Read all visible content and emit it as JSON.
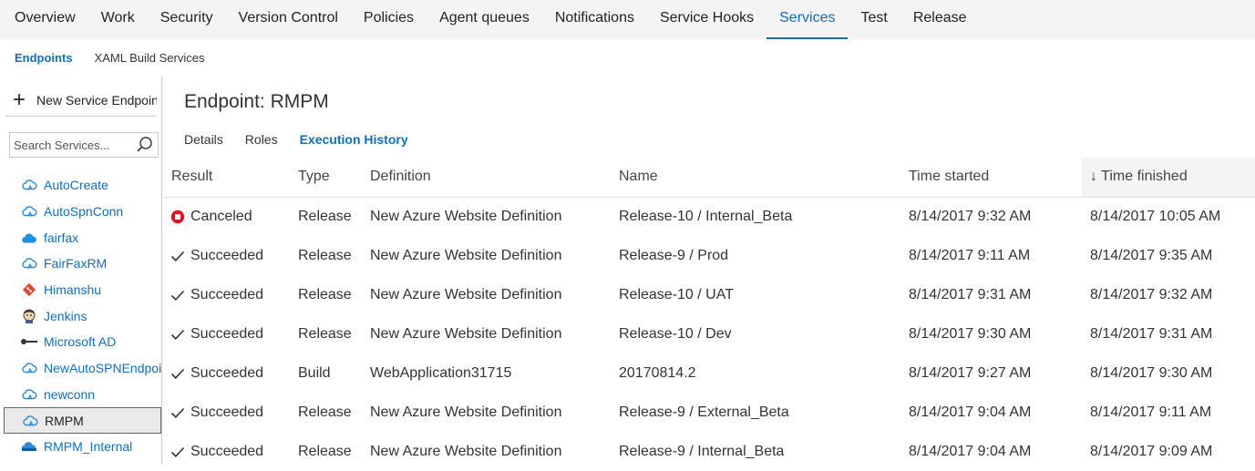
{
  "topnav": {
    "tabs": [
      "Overview",
      "Work",
      "Security",
      "Version Control",
      "Policies",
      "Agent queues",
      "Notifications",
      "Service Hooks",
      "Services",
      "Test",
      "Release"
    ],
    "active": "Services"
  },
  "subnav": {
    "endpoints": "Endpoints",
    "xaml": "XAML Build Services"
  },
  "left": {
    "new_button": "New Service Endpoint",
    "search_placeholder": "Search Services...",
    "services": [
      {
        "label": "AutoCreate",
        "icon": "azure-cloud-icon"
      },
      {
        "label": "AutoSpnConn",
        "icon": "azure-cloud-icon"
      },
      {
        "label": "fairfax",
        "icon": "cloud-icon"
      },
      {
        "label": "FairFaxRM",
        "icon": "azure-cloud-icon"
      },
      {
        "label": "Himanshu",
        "icon": "git-icon"
      },
      {
        "label": "Jenkins",
        "icon": "jenkins-icon"
      },
      {
        "label": "Microsoft AD",
        "icon": "key-icon"
      },
      {
        "label": "NewAutoSPNEndpoint",
        "icon": "azure-cloud-icon"
      },
      {
        "label": "newconn",
        "icon": "azure-cloud-icon"
      },
      {
        "label": "RMPM",
        "icon": "azure-cloud-icon"
      },
      {
        "label": "RMPM_Internal",
        "icon": "azure-rm-icon"
      }
    ],
    "selected": "RMPM"
  },
  "main": {
    "title": "Endpoint: RMPM",
    "tabs": [
      "Details",
      "Roles",
      "Execution History"
    ],
    "active_tab": "Execution History",
    "columns": [
      "Result",
      "Type",
      "Definition",
      "Name",
      "Time started",
      "Time finished"
    ],
    "sort_arrow": "↓",
    "rows": [
      {
        "result": "Canceled",
        "status": "canceled",
        "type": "Release",
        "definition": "New Azure Website Definition",
        "name": "Release-10 / Internal_Beta",
        "started": "8/14/2017 9:32 AM",
        "finished": "8/14/2017 10:05 AM"
      },
      {
        "result": "Succeeded",
        "status": "succeeded",
        "type": "Release",
        "definition": "New Azure Website Definition",
        "name": "Release-9 / Prod",
        "started": "8/14/2017 9:11 AM",
        "finished": "8/14/2017 9:35 AM"
      },
      {
        "result": "Succeeded",
        "status": "succeeded",
        "type": "Release",
        "definition": "New Azure Website Definition",
        "name": "Release-10 / UAT",
        "started": "8/14/2017 9:31 AM",
        "finished": "8/14/2017 9:32 AM"
      },
      {
        "result": "Succeeded",
        "status": "succeeded",
        "type": "Release",
        "definition": "New Azure Website Definition",
        "name": "Release-10 / Dev",
        "started": "8/14/2017 9:30 AM",
        "finished": "8/14/2017 9:31 AM"
      },
      {
        "result": "Succeeded",
        "status": "succeeded",
        "type": "Build",
        "definition": "WebApplication31715",
        "name": "20170814.2",
        "started": "8/14/2017 9:27 AM",
        "finished": "8/14/2017 9:30 AM"
      },
      {
        "result": "Succeeded",
        "status": "succeeded",
        "type": "Release",
        "definition": "New Azure Website Definition",
        "name": "Release-9 / External_Beta",
        "started": "8/14/2017 9:04 AM",
        "finished": "8/14/2017 9:11 AM"
      },
      {
        "result": "Succeeded",
        "status": "succeeded",
        "type": "Release",
        "definition": "New Azure Website Definition",
        "name": "Release-9 / Internal_Beta",
        "started": "8/14/2017 9:04 AM",
        "finished": "8/14/2017 9:09 AM"
      }
    ]
  },
  "colors": {
    "accent": "#106ebe",
    "canceled": "#e81123",
    "git": "#e2452e"
  }
}
